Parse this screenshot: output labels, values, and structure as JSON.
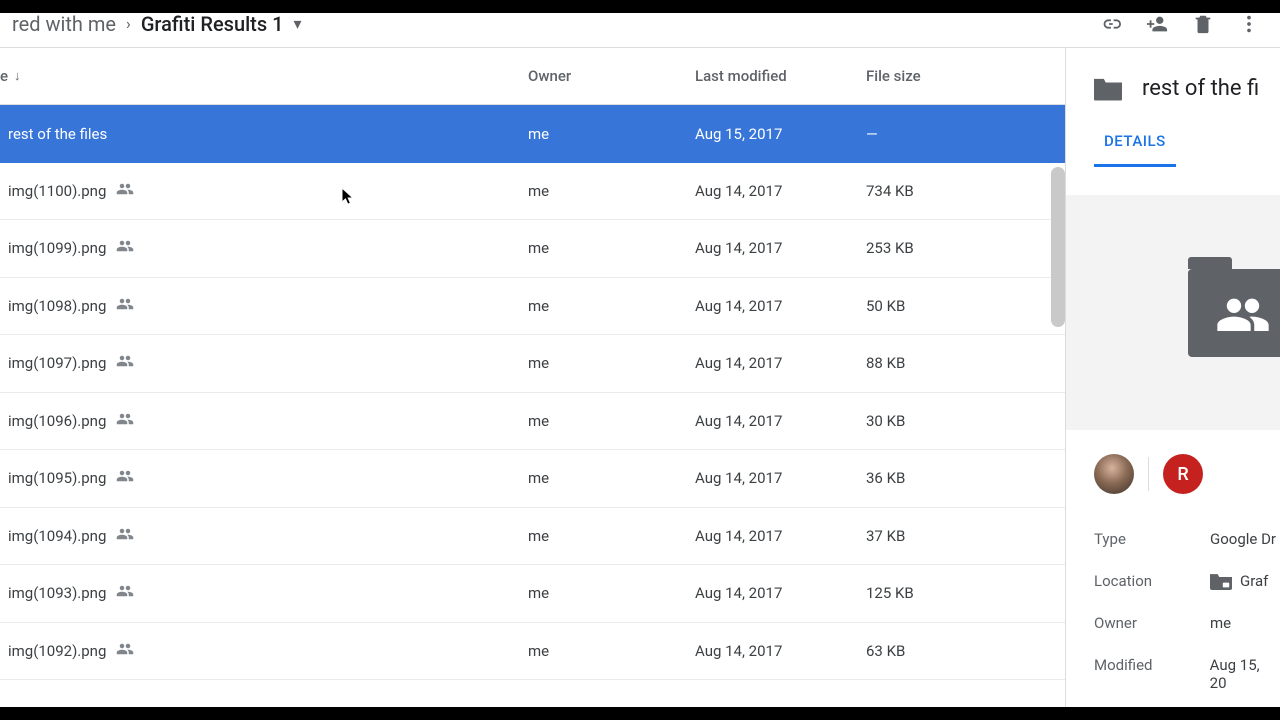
{
  "breadcrumb": {
    "prev": "red with me",
    "current": "Grafiti Results 1"
  },
  "columns": {
    "name": "e",
    "owner": "Owner",
    "modified": "Last modified",
    "size": "File size"
  },
  "rows": [
    {
      "name": "rest of the files",
      "owner": "me",
      "modified": "Aug 15, 2017",
      "size": "—",
      "shared": false,
      "selected": true
    },
    {
      "name": "img(1100).png",
      "owner": "me",
      "modified": "Aug 14, 2017",
      "size": "734 KB",
      "shared": true,
      "selected": false
    },
    {
      "name": "img(1099).png",
      "owner": "me",
      "modified": "Aug 14, 2017",
      "size": "253 KB",
      "shared": true,
      "selected": false
    },
    {
      "name": "img(1098).png",
      "owner": "me",
      "modified": "Aug 14, 2017",
      "size": "50 KB",
      "shared": true,
      "selected": false
    },
    {
      "name": "img(1097).png",
      "owner": "me",
      "modified": "Aug 14, 2017",
      "size": "88 KB",
      "shared": true,
      "selected": false
    },
    {
      "name": "img(1096).png",
      "owner": "me",
      "modified": "Aug 14, 2017",
      "size": "30 KB",
      "shared": true,
      "selected": false
    },
    {
      "name": "img(1095).png",
      "owner": "me",
      "modified": "Aug 14, 2017",
      "size": "36 KB",
      "shared": true,
      "selected": false
    },
    {
      "name": "img(1094).png",
      "owner": "me",
      "modified": "Aug 14, 2017",
      "size": "37 KB",
      "shared": true,
      "selected": false
    },
    {
      "name": "img(1093).png",
      "owner": "me",
      "modified": "Aug 14, 2017",
      "size": "125 KB",
      "shared": true,
      "selected": false
    },
    {
      "name": "img(1092).png",
      "owner": "me",
      "modified": "Aug 14, 2017",
      "size": "63 KB",
      "shared": true,
      "selected": false
    }
  ],
  "details": {
    "title": "rest of the fi",
    "tab": "DETAILS",
    "avatar_letter": "R",
    "meta": {
      "type_label": "Type",
      "type_value": "Google Dr",
      "location_label": "Location",
      "location_value": "Graf",
      "owner_label": "Owner",
      "owner_value": "me",
      "modified_label": "Modified",
      "modified_value": "Aug 15, 20"
    }
  }
}
